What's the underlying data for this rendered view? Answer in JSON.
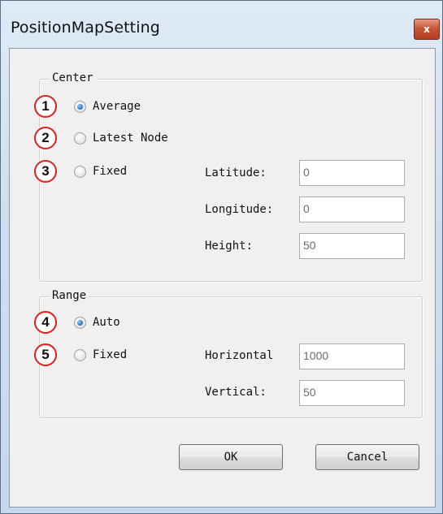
{
  "window": {
    "title": "PositionMapSetting",
    "close_glyph": "x"
  },
  "center": {
    "legend": "Center",
    "options": [
      {
        "badge": "1",
        "label": "Average",
        "checked": true
      },
      {
        "badge": "2",
        "label": "Latest Node",
        "checked": false
      },
      {
        "badge": "3",
        "label": "Fixed",
        "checked": false
      }
    ],
    "latitude_label": "Latitude:",
    "latitude_value": "0",
    "longitude_label": "Longitude:",
    "longitude_value": "0",
    "height_label": "Height:",
    "height_value": "50"
  },
  "range": {
    "legend": "Range",
    "options": [
      {
        "badge": "4",
        "label": "Auto",
        "checked": true
      },
      {
        "badge": "5",
        "label": "Fixed",
        "checked": false
      }
    ],
    "horizontal_label": "Horizontal",
    "horizontal_value": "1000",
    "vertical_label": "Vertical:",
    "vertical_value": "50"
  },
  "buttons": {
    "ok": "OK",
    "cancel": "Cancel"
  },
  "colors": {
    "badge_border": "#e02020",
    "radio_checked": "#2b7fd4"
  }
}
